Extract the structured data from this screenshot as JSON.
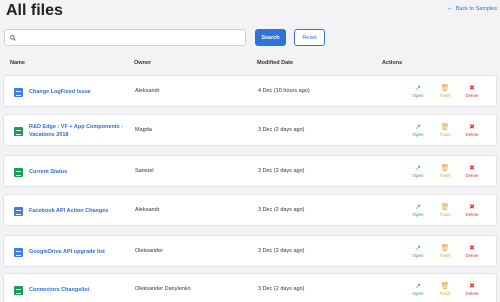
{
  "page": {
    "title": "All files",
    "back_link": "Back to Samples"
  },
  "search": {
    "placeholder": "",
    "value": "",
    "search_label": "Search",
    "reset_label": "Reset"
  },
  "columns": {
    "name": "Name",
    "owner": "Owner",
    "modified": "Modified Date",
    "actions": "Actions"
  },
  "actions": {
    "open": "Open",
    "trash": "Trash",
    "delete": "Delete"
  },
  "files": [
    {
      "name": "Change LogFixed Issue",
      "owner": "Aleksandr",
      "modified": "4 Dec (10 hours ago)",
      "icon": "doc-icon"
    },
    {
      "name": "R&D Edge : VF + App Components - Vacations 2018",
      "owner": "Magda",
      "modified": "3 Dec (2 days ago)",
      "icon": "sheet-icon"
    },
    {
      "name": "Current Status",
      "owner": "Samuel",
      "modified": "3 Dec (2 days ago)",
      "icon": "sheet-icon"
    },
    {
      "name": "Facebook API Action Changes",
      "owner": "Aleksandr",
      "modified": "3 Dec (2 days ago)",
      "icon": "doc-icon"
    },
    {
      "name": "GoogleDrive API upgrade list",
      "owner": "Oleksander",
      "modified": "3 Dec (2 days ago)",
      "icon": "doc-icon"
    },
    {
      "name": "Connectors Changelist",
      "owner": "Oleksander Danylenko",
      "modified": "3 Dec (2 days ago)",
      "icon": "sheet-icon"
    }
  ],
  "colors": {
    "accent": "#2f74d6",
    "open": "#2eaa4a",
    "trash": "#d9a441",
    "delete": "#d93a3a",
    "doc": "#3f7fe3",
    "sheet": "#1e9d58"
  }
}
